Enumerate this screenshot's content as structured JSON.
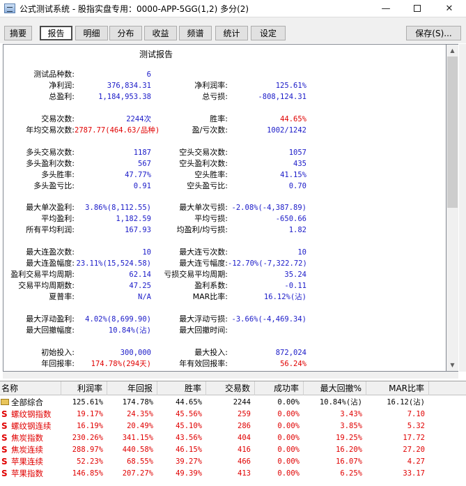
{
  "window": {
    "title": "公式测试系统 - 股指实盘专用：0000-APP-5GG(1,2) 多分(2)",
    "minimize": "—",
    "close": "✕"
  },
  "toolbar": {
    "tabs": [
      "摘要",
      "报告",
      "明细",
      "分布",
      "收益",
      "频谱",
      "统计",
      "设定"
    ],
    "active_tab": "报告",
    "save_label": "保存(S)..."
  },
  "report": {
    "title": "测试报告",
    "rows": [
      {
        "l1": "测试品种数:",
        "v1": "6",
        "l2": "",
        "v2": ""
      },
      {
        "l1": "净利润:",
        "v1": "376,834.31",
        "l2": "净利润率:",
        "v2": "125.61%"
      },
      {
        "l1": "总盈利:",
        "v1": "1,184,953.38",
        "l2": "总亏损:",
        "v2": "-808,124.31"
      },
      {
        "l1": "交易次数:",
        "v1": "2244次",
        "l2": "胜率:",
        "v2": "44.65%"
      },
      {
        "l1": "年均交易次数:",
        "v1": "2787.77(464.63/品种)",
        "l2": "盈/亏次数:",
        "v2": "1002/1242"
      },
      {
        "l1": "多头交易次数:",
        "v1": "1187",
        "l2": "空头交易次数:",
        "v2": "1057"
      },
      {
        "l1": "多头盈利次数:",
        "v1": "567",
        "l2": "空头盈利次数:",
        "v2": "435"
      },
      {
        "l1": "多头胜率:",
        "v1": "47.77%",
        "l2": "空头胜率:",
        "v2": "41.15%"
      },
      {
        "l1": "多头盈亏比:",
        "v1": "0.91",
        "l2": "空头盈亏比:",
        "v2": "0.70"
      },
      {
        "l1": "最大单次盈利:",
        "v1": "3.86%(8,112.55)",
        "l2": "最大单次亏损:",
        "v2": "-2.08%(-4,387.89)"
      },
      {
        "l1": "平均盈利:",
        "v1": "1,182.59",
        "l2": "平均亏损:",
        "v2": "-650.66"
      },
      {
        "l1": "所有平均利润:",
        "v1": "167.93",
        "l2": "均盈利/均亏损:",
        "v2": "1.82"
      },
      {
        "l1": "最大连盈次数:",
        "v1": "10",
        "l2": "最大连亏次数:",
        "v2": "10"
      },
      {
        "l1": "最大连盈幅度:",
        "v1": "23.11%(15,524.58)",
        "l2": "最大连亏幅度:",
        "v2": "-12.70%(-7,322.72)"
      },
      {
        "l1": "盈利交易平均周期:",
        "v1": "62.14",
        "l2": "亏损交易平均周期:",
        "v2": "35.24"
      },
      {
        "l1": "交易平均周期数:",
        "v1": "47.25",
        "l2": "盈利系数:",
        "v2": "-0.11"
      },
      {
        "l1": "夏普率:",
        "v1": "N/A",
        "l2": "MAR比率:",
        "v2": "16.12%(沾)"
      },
      {
        "l1": "最大浮动盈利:",
        "v1": "4.02%(8,699.90)",
        "l2": "最大浮动亏损:",
        "v2": "-3.66%(-4,469.34)"
      },
      {
        "l1": "最大回撤幅度:",
        "v1": "10.84%(沾)",
        "l2": "最大回撤时间:",
        "v2": ""
      },
      {
        "l1": "初始投入:",
        "v1": "300,000",
        "l2": "最大投入:",
        "v2": "872,024"
      },
      {
        "l1": "年回报率:",
        "v1": "174.78%(294天)",
        "l2": "年有效回报率:",
        "v2": "56.24%"
      }
    ]
  },
  "grid": {
    "headers": [
      "名称",
      "利润率",
      "年回报",
      "胜率",
      "交易数",
      "成功率",
      "最大回撤%",
      "MAR比率"
    ],
    "summary": {
      "name": "全部综合",
      "cells": [
        "125.61%",
        "174.78%",
        "44.65%",
        "2244",
        "0.00%",
        "10.84%(沾)",
        "16.12(沾)"
      ]
    },
    "rows": [
      {
        "icon": "S",
        "name": "螺纹钢指数",
        "cells": [
          "19.17%",
          "24.35%",
          "45.56%",
          "259",
          "0.00%",
          "3.43%",
          "7.10"
        ]
      },
      {
        "icon": "S",
        "name": "螺纹钢连续",
        "cells": [
          "16.19%",
          "20.49%",
          "45.10%",
          "286",
          "0.00%",
          "3.85%",
          "5.32"
        ]
      },
      {
        "icon": "S",
        "name": "焦炭指数",
        "cells": [
          "230.26%",
          "341.15%",
          "43.56%",
          "404",
          "0.00%",
          "19.25%",
          "17.72"
        ]
      },
      {
        "icon": "S",
        "name": "焦炭连续",
        "cells": [
          "288.97%",
          "440.58%",
          "46.15%",
          "416",
          "0.00%",
          "16.20%",
          "27.20"
        ]
      },
      {
        "icon": "S",
        "name": "苹果连续",
        "cells": [
          "52.23%",
          "68.55%",
          "39.27%",
          "466",
          "0.00%",
          "16.07%",
          "4.27"
        ]
      },
      {
        "icon": "S",
        "name": "苹果指数",
        "cells": [
          "146.85%",
          "207.27%",
          "49.39%",
          "413",
          "0.00%",
          "6.25%",
          "33.17"
        ]
      }
    ]
  }
}
